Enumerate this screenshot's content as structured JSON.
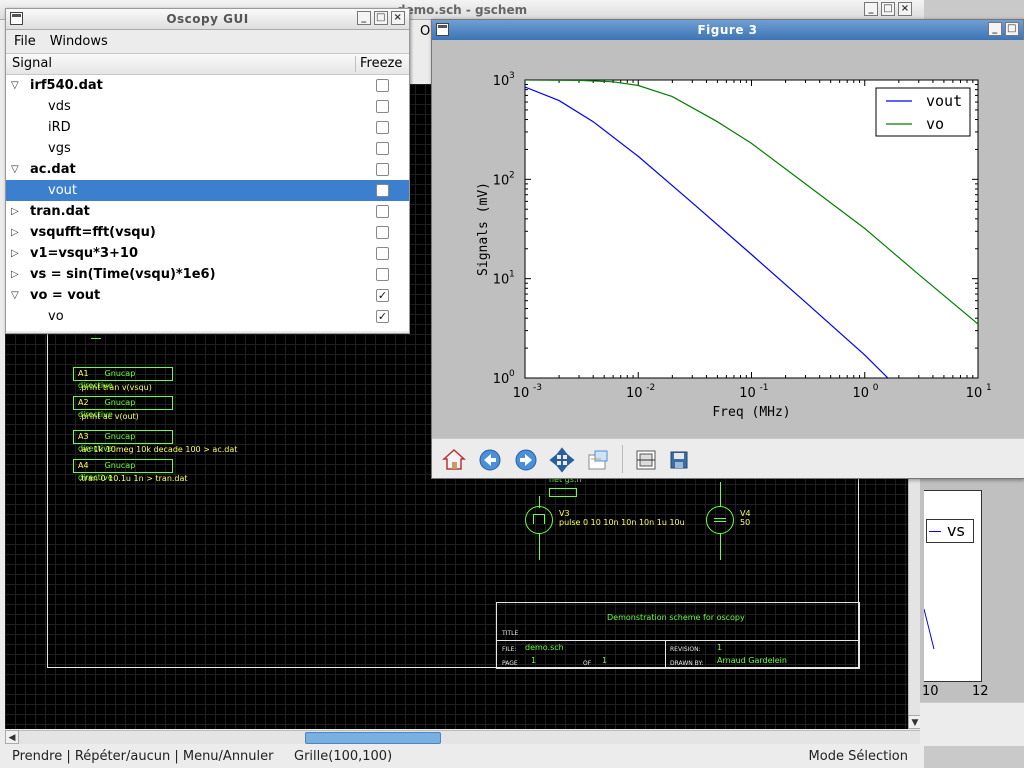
{
  "gschem": {
    "title": "demo.sch - gschem",
    "menu_partial": "O",
    "status": {
      "left": "Prendre | Répéter/aucun | Menu/Annuler",
      "grid": "Grille(100,100)",
      "mode": "Mode Sélection"
    },
    "schematic": {
      "directives": [
        {
          "ref": "A1",
          "label": "Gnucap directive",
          "text": ".print tran v(vsqu)"
        },
        {
          "ref": "A2",
          "label": "Gnucap directive",
          "text": ".print ac v(out)"
        },
        {
          "ref": "A3",
          "label": "Gnucap directive",
          "text": ".ac 1k 10meg 10k decade 100 > ac.dat"
        },
        {
          "ref": "A4",
          "label": "Gnucap directive",
          "text": ".tran 0 10.1u 1n > tran.dat"
        }
      ],
      "v3_ref": "V3",
      "v3_value": "pulse 0 10 10n 10n 10n 1u 10u",
      "v4_ref": "V4",
      "v4_value": "50",
      "net_label": "net gs.n",
      "title_block": {
        "heading": "Demonstration scheme for oscopy",
        "title_lbl": "TITLE",
        "file_lbl": "FILE:",
        "file_val": "demo.sch",
        "page_lbl": "PAGE",
        "page_val": "1",
        "of_lbl": "OF",
        "of_val": "1",
        "revision_lbl": "REVISION:",
        "revision_val": "1",
        "drawn_lbl": "DRAWN BY:",
        "drawn_val": "Arnaud Gardelein"
      }
    }
  },
  "plot2": {
    "legend": "vs",
    "ticks": [
      "10",
      "12"
    ]
  },
  "oscopy": {
    "title": "Oscopy GUI",
    "menu": [
      "File",
      "Windows"
    ],
    "columns": [
      "Signal",
      "Freeze"
    ],
    "rows": [
      {
        "label": "irf540.dat",
        "level": 0,
        "expander": "open",
        "checked": false
      },
      {
        "label": "vds",
        "level": 1,
        "checked": false
      },
      {
        "label": "iRD",
        "level": 1,
        "checked": false
      },
      {
        "label": "vgs",
        "level": 1,
        "checked": false
      },
      {
        "label": "ac.dat",
        "level": 0,
        "expander": "open",
        "checked": false
      },
      {
        "label": "vout",
        "level": 1,
        "checked": false,
        "selected": true
      },
      {
        "label": "tran.dat",
        "level": 0,
        "expander": "closed",
        "checked": false
      },
      {
        "label": "vsqufft=fft(vsqu)",
        "level": 0,
        "expander": "closed",
        "checked": false
      },
      {
        "label": "v1=vsqu*3+10",
        "level": 0,
        "expander": "closed",
        "checked": false
      },
      {
        "label": "vs = sin(Time(vsqu)*1e6)",
        "level": 0,
        "expander": "closed",
        "checked": false
      },
      {
        "label": "vo = vout",
        "level": 0,
        "expander": "open",
        "checked": true
      },
      {
        "label": "vo",
        "level": 1,
        "checked": true
      }
    ]
  },
  "figure": {
    "title": "Figure 3",
    "toolbar": [
      "home-icon",
      "back-icon",
      "forward-icon",
      "pan-icon",
      "zoom-icon",
      "subplots-icon",
      "save-icon"
    ]
  },
  "chart_data": {
    "type": "line",
    "xlabel": "Freq (MHz)",
    "ylabel": "Signals (mV)",
    "xscale": "log",
    "yscale": "log",
    "xlim": [
      0.001,
      10
    ],
    "ylim": [
      1,
      1000
    ],
    "x_ticks": [
      "10",
      "10",
      "10",
      "10",
      "10"
    ],
    "x_tick_exponents": [
      "-3",
      "-2",
      "-1",
      "0",
      "1"
    ],
    "y_ticks": [
      "10",
      "10",
      "10",
      "10"
    ],
    "y_tick_exponents": [
      "0",
      "1",
      "2",
      "3"
    ],
    "legend_position": "top-right",
    "grid": false,
    "series": [
      {
        "name": "vout",
        "color": "#0000ff",
        "x": [
          0.001,
          0.002,
          0.004,
          0.01,
          0.03,
          0.1,
          0.3,
          1.0,
          1.6
        ],
        "y": [
          850,
          620,
          380,
          170,
          58,
          17.5,
          5.8,
          1.7,
          1.0
        ]
      },
      {
        "name": "vo",
        "color": "#008000",
        "x": [
          0.001,
          0.003,
          0.006,
          0.01,
          0.02,
          0.05,
          0.1,
          0.3,
          1.0,
          3.0,
          10.0
        ],
        "y": [
          1000,
          990,
          960,
          880,
          680,
          380,
          230,
          90,
          32,
          11,
          3.5
        ]
      }
    ]
  }
}
